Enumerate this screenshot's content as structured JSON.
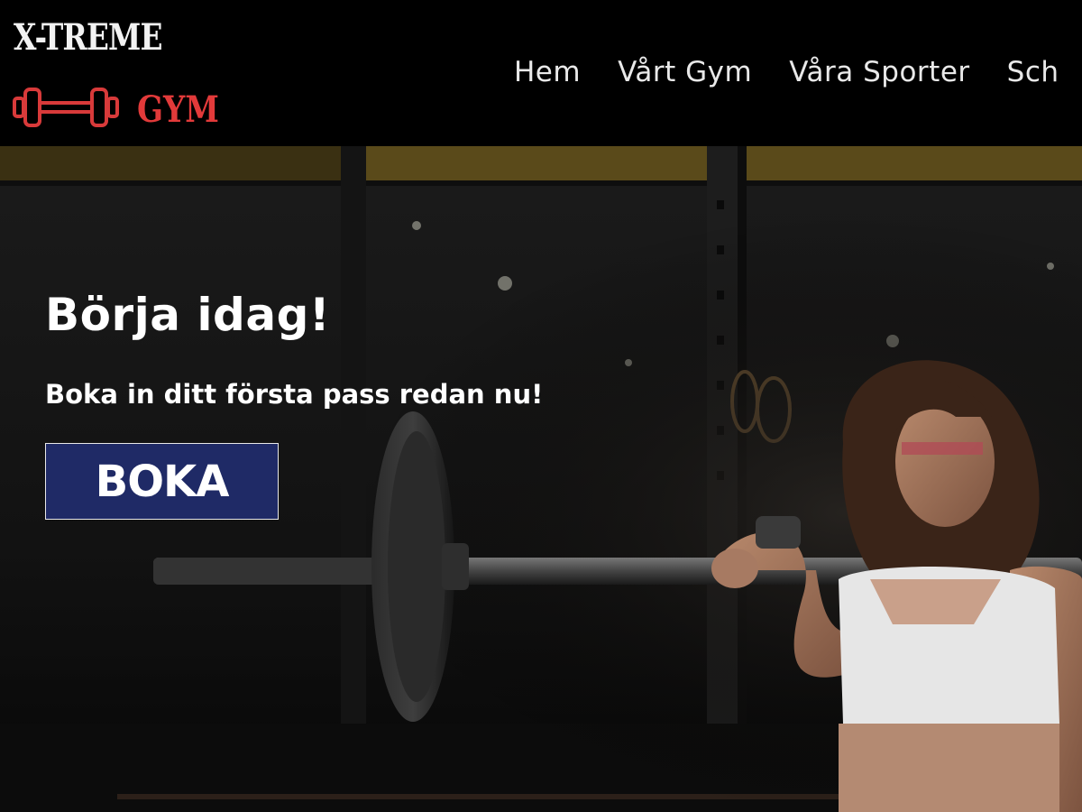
{
  "header": {
    "logo": {
      "line1": "X-TREME",
      "line2": "GYM",
      "icon": "dumbbell-icon",
      "colors": {
        "line1": "#f2f2f2",
        "line2": "#e23a3a"
      }
    },
    "nav": [
      {
        "label": "Hem"
      },
      {
        "label": "Vårt Gym"
      },
      {
        "label": "Våra Sporter"
      },
      {
        "label": "Sch"
      }
    ]
  },
  "hero": {
    "title": "Börja idag!",
    "subtitle": "Boka in ditt första pass redan nu!",
    "button_label": "BOKA",
    "button_color": "#1f2a66",
    "background_image": "woman-lifting-barbell-in-dark-gym"
  }
}
